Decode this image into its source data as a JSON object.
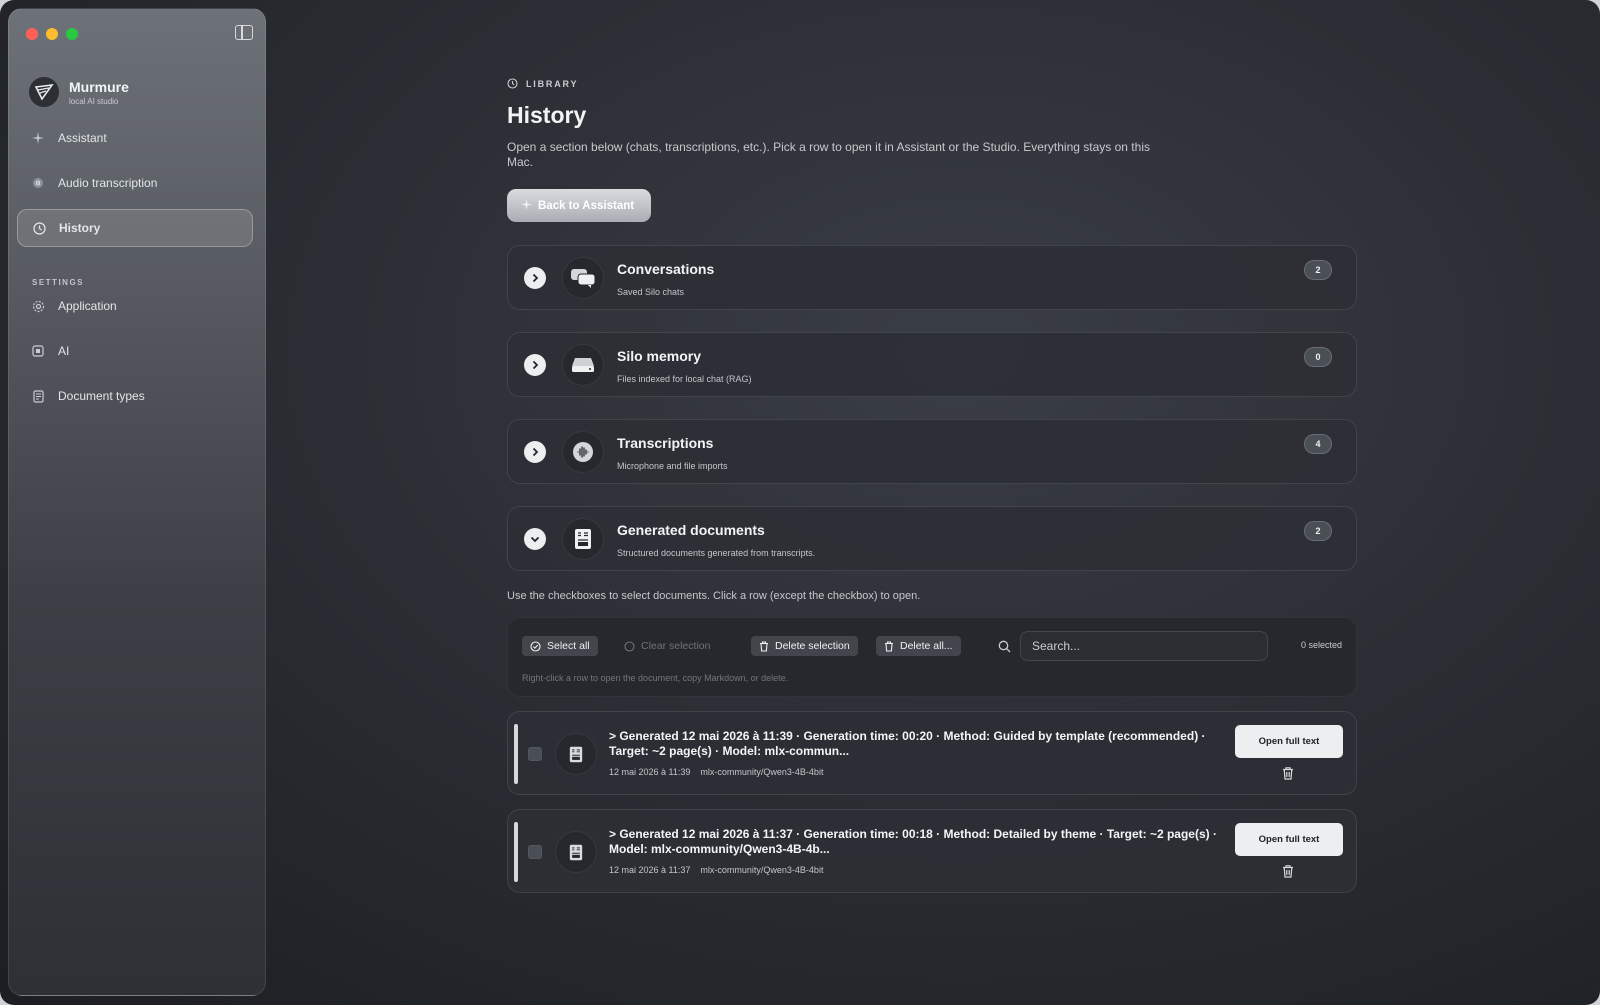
{
  "app": {
    "name": "Murmure",
    "subtitle": "local AI studio"
  },
  "sidebar": {
    "items": [
      {
        "label": "Assistant",
        "icon": "sparkle-icon"
      },
      {
        "label": "Audio transcription",
        "icon": "waveform-icon"
      },
      {
        "label": "History",
        "icon": "clock-icon",
        "active": true
      }
    ],
    "settings_label": "SETTINGS",
    "settings_items": [
      {
        "label": "Application",
        "icon": "gear-icon"
      },
      {
        "label": "AI",
        "icon": "chip-icon"
      },
      {
        "label": "Document types",
        "icon": "document-icon"
      }
    ]
  },
  "main": {
    "crumb": "LIBRARY",
    "title": "History",
    "description": "Open a section below (chats, transcriptions, etc.). Pick a row to open it in Assistant or the Studio. Everything stays on this Mac.",
    "back_button": "Back to Assistant",
    "sections": [
      {
        "title": "Conversations",
        "subtitle": "Saved Silo chats",
        "count": "2",
        "expanded": false,
        "icon": "chat-bubbles-icon"
      },
      {
        "title": "Silo memory",
        "subtitle": "Files indexed for local chat (RAG)",
        "count": "0",
        "expanded": false,
        "icon": "drive-icon"
      },
      {
        "title": "Transcriptions",
        "subtitle": "Microphone and file imports",
        "count": "4",
        "expanded": false,
        "icon": "waveform-icon"
      },
      {
        "title": "Generated documents",
        "subtitle": "Structured documents generated from transcripts.",
        "count": "2",
        "expanded": true,
        "icon": "document-icon"
      }
    ],
    "helper_text": "Use the checkboxes to select documents. Click a row (except the checkbox) to open.",
    "toolbar": {
      "select_all": "Select all",
      "clear_selection": "Clear selection",
      "delete_selection": "Delete selection",
      "delete_all": "Delete all...",
      "search_placeholder": "Search...",
      "selected_count": "0 selected",
      "hint": "Right-click a row to open the document, copy Markdown, or delete."
    },
    "documents": [
      {
        "title": "> Generated 12 mai 2026 à 11:39 · Generation time: 00:20 · Method: Guided by template (recommended) · Target: ~2 page(s) · Model: mlx-commun...",
        "date": "12 mai 2026 à 11:39",
        "model": "mlx-community/Qwen3-4B-4bit",
        "open_label": "Open full text"
      },
      {
        "title": "> Generated 12 mai 2026 à 11:37 · Generation time: 00:18 · Method: Detailed by theme · Target: ~2 page(s) · Model: mlx-community/Qwen3-4B-4b...",
        "date": "12 mai 2026 à 11:37",
        "model": "mlx-community/Qwen3-4B-4bit",
        "open_label": "Open full text"
      }
    ]
  },
  "colors": {
    "traffic_red": "#ff5f57",
    "traffic_yellow": "#febc2e",
    "traffic_green": "#28c840"
  }
}
